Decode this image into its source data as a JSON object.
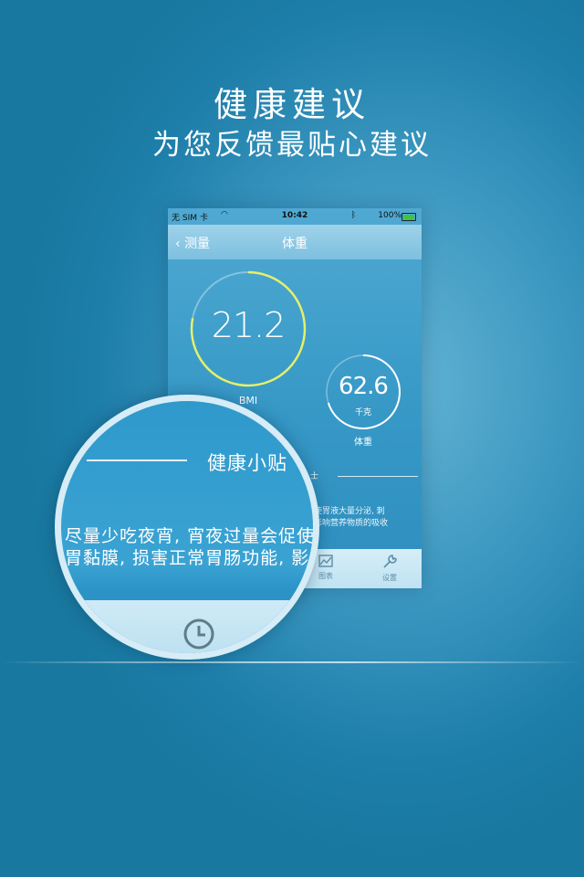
{
  "headline": {
    "title": "健康建议",
    "subtitle": "为您反馈最贴心建议"
  },
  "phone": {
    "status": {
      "carrier": "无 SIM 卡",
      "time": "10:42",
      "battery": "100%"
    },
    "nav": {
      "back_label": "测量",
      "title": "体重"
    },
    "bmi": {
      "value": "21.2",
      "label": "BMI",
      "progress": 0.78
    },
    "weight": {
      "value": "62.6",
      "unit": "千克",
      "label": "体重",
      "progress": 0.7
    },
    "tip_fragment_title": "士",
    "tip_fragment": [
      "使胃液大量分泌, 刺",
      "影响营养物质的吸收"
    ],
    "tabs": [
      {
        "label": "图表",
        "icon": "chart-icon"
      },
      {
        "label": "设置",
        "icon": "wrench-icon"
      }
    ]
  },
  "magnifier": {
    "title": "健康小贴",
    "paragraph_line1": "尽量少吃夜宵, 宵夜过量会促使",
    "paragraph_line2": "胃黏膜, 损害正常胃肠功能, 影",
    "tab_icon": "clock-icon"
  },
  "colors": {
    "ring_accent": "#e6ef6a",
    "ring_track": "#ffffff",
    "background": "#1d7ea9"
  }
}
